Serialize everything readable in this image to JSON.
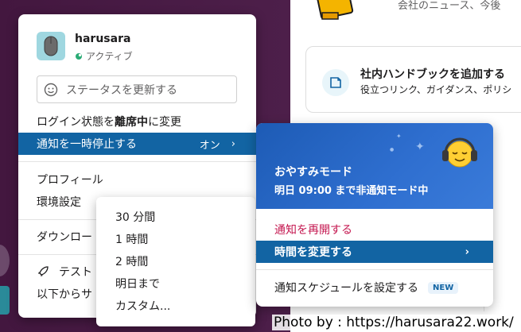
{
  "background": {
    "top_text": "会社のニュース、今後",
    "handbook": {
      "title": "社内ハンドブックを追加する",
      "description": "役立つリンク、ガイダンス、ポリシ"
    }
  },
  "user_menu": {
    "user_name": "harusara",
    "presence": "アクティブ",
    "status_placeholder": "ステータスを更新する",
    "items": {
      "login_prefix": "ログイン状態を",
      "login_bold": "離席中",
      "login_suffix": "に変更",
      "pause_notifications": "通知を一時停止する",
      "pause_state": "オン",
      "profile": "プロフィール",
      "preferences": "環境設定",
      "download": "ダウンロー",
      "test": "テスト",
      "from_below": "以下からサ"
    }
  },
  "duration_menu": {
    "items": [
      "30 分間",
      "1 時間",
      "2 時間",
      "明日まで",
      "カスタム..."
    ]
  },
  "dnd_panel": {
    "title": "おやすみモード",
    "subtitle": "明日 09:00 まで非通知モード中",
    "resume": "通知を再開する",
    "change_time": "時間を変更する",
    "schedule": "通知スケジュールを設定する",
    "new_badge": "NEW"
  },
  "watermark": "Photo by : https://harusara22.work/",
  "colors": {
    "accent": "#1264a3",
    "sidebar": "#4a154b",
    "resume_text": "#c4164f",
    "presence_green": "#2bac76"
  }
}
